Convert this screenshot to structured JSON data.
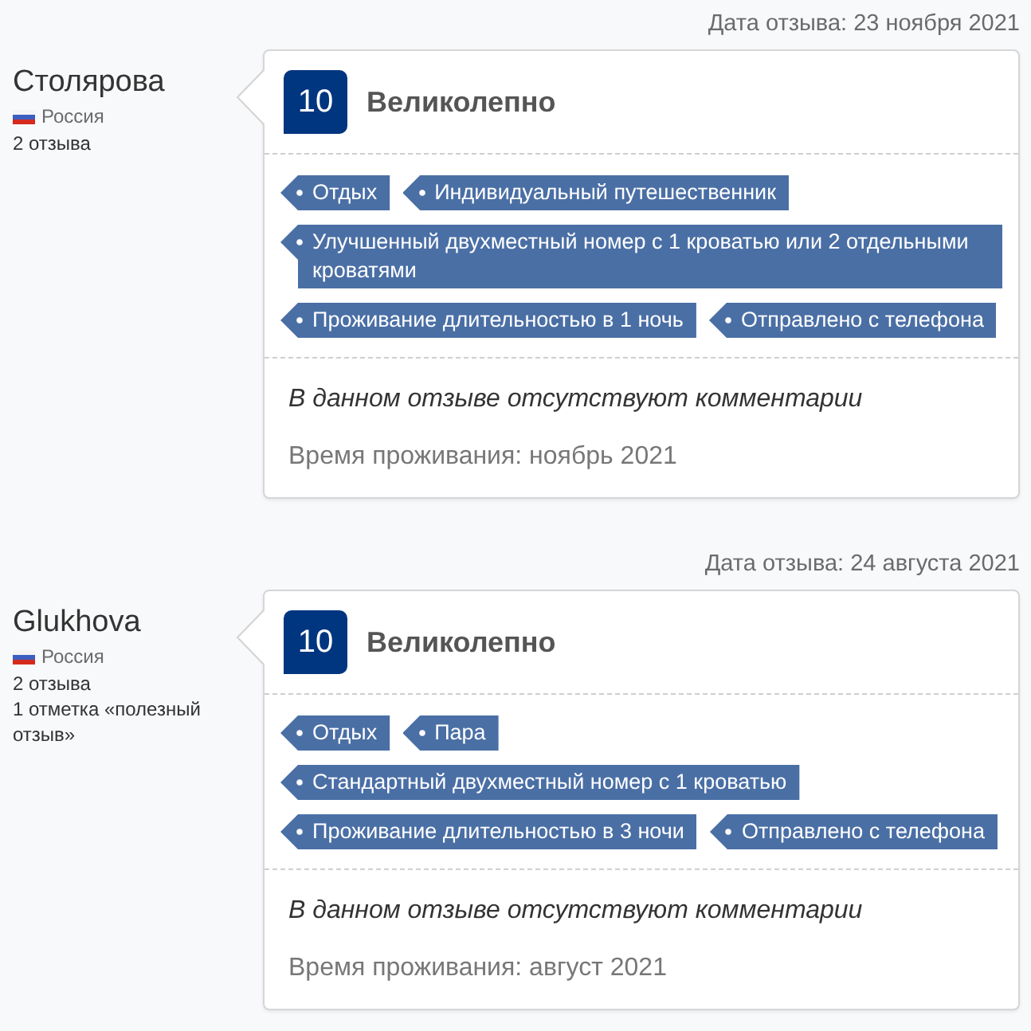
{
  "reviews": [
    {
      "date": "Дата отзыва: 23 ноября 2021",
      "reviewer": {
        "name": "Столярова",
        "country": "Россия",
        "details": [
          "2 отзыва"
        ]
      },
      "score": "10",
      "verdict": "Великолепно",
      "tags": [
        "Отдых",
        "Индивидуальный путешественник",
        "Улучшенный двухместный номер с 1 кроватью или 2 отдельными кроватями",
        "Проживание длительностью в 1 ночь",
        "Отправлено с телефона"
      ],
      "comment": "В данном отзыве отсутствуют комментарии",
      "stay": "Время проживания: ноябрь 2021"
    },
    {
      "date": "Дата отзыва: 24 августа 2021",
      "reviewer": {
        "name": "Glukhova",
        "country": "Россия",
        "details": [
          "2 отзыва",
          "1 отметка «полезный отзыв»"
        ]
      },
      "score": "10",
      "verdict": "Великолепно",
      "tags": [
        "Отдых",
        "Пара",
        "Стандартный двухместный номер с 1 кроватью",
        "Проживание длительностью в 3 ночи",
        "Отправлено с телефона"
      ],
      "comment": "В данном отзыве отсутствуют комментарии",
      "stay": "Время проживания: август 2021"
    }
  ]
}
